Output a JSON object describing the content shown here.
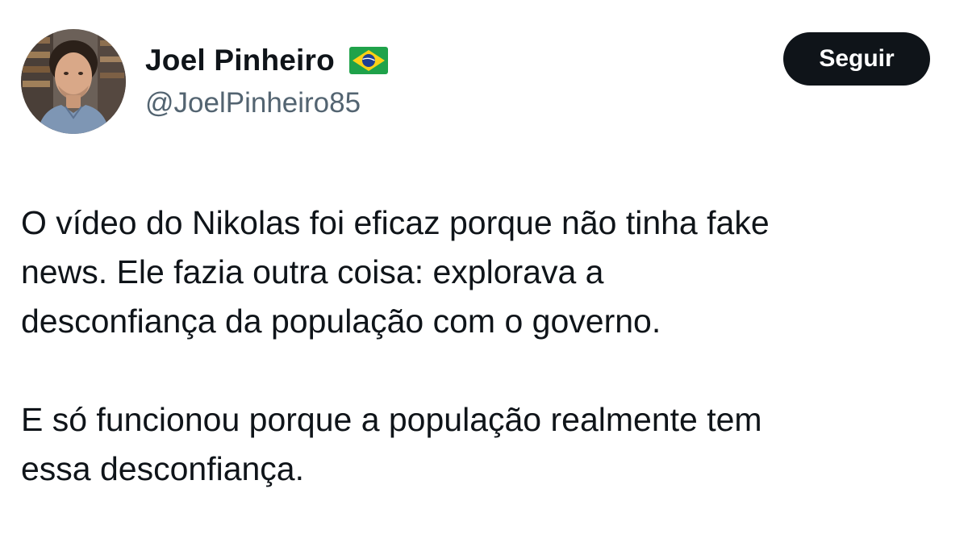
{
  "author": {
    "display_name": "Joel Pinheiro",
    "flag_icon": "brazil-flag-icon",
    "handle": "@JoelPinheiro85",
    "avatar_icon": "avatar-photo"
  },
  "actions": {
    "follow_label": "Seguir"
  },
  "tweet": {
    "paragraphs": [
      {
        "lines": [
          "O vídeo do Nikolas foi eficaz porque não tinha fake",
          "news. Ele fazia outra coisa: explorava a",
          "desconfiança da população com o governo."
        ]
      },
      {
        "lines": [
          "E só funcionou porque a população realmente tem",
          "essa desconfiança."
        ]
      }
    ]
  },
  "colors": {
    "text_primary": "#0f1419",
    "text_secondary": "#536471",
    "button_bg": "#0f1419",
    "button_text": "#ffffff"
  }
}
